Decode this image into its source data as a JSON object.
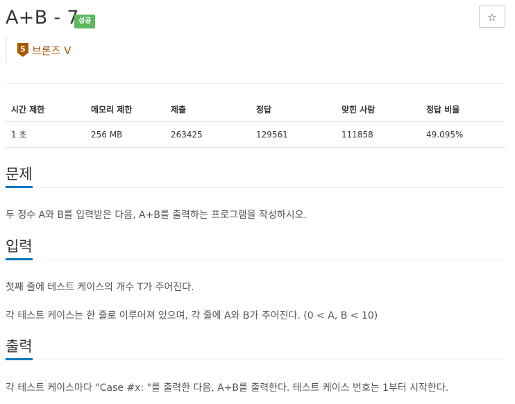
{
  "problem": {
    "title": "A+B - 7",
    "status_badge": "성공",
    "star_label": "☆",
    "tier": {
      "number": "5",
      "label": "브론즈 V",
      "color": "#ad5600"
    }
  },
  "info_table": {
    "headers": [
      "시간 제한",
      "메모리 제한",
      "제출",
      "정답",
      "맞힌 사람",
      "정답 비율"
    ],
    "row": [
      "1 초",
      "256 MB",
      "263425",
      "129561",
      "111858",
      "49.095%"
    ]
  },
  "sections": {
    "problem": {
      "heading": "문제",
      "paragraphs": [
        "두 정수 A와 B를 입력받은 다음, A+B를 출력하는 프로그램을 작성하시오."
      ]
    },
    "input": {
      "heading": "입력",
      "paragraphs": [
        "첫째 줄에 테스트 케이스의 개수 T가 주어진다.",
        "각 테스트 케이스는 한 줄로 이루어져 있으며, 각 줄에 A와 B가 주어진다. (0 < A, B < 10)"
      ]
    },
    "output": {
      "heading": "출력",
      "paragraphs": [
        "각 테스트 케이스마다 \"Case #x: \"를 출력한 다음, A+B를 출력한다. 테스트 케이스 번호는 1부터 시작한다."
      ]
    }
  },
  "colors": {
    "accent": "#0076c0",
    "success": "#5cb85c",
    "bronze": "#ad5600"
  }
}
